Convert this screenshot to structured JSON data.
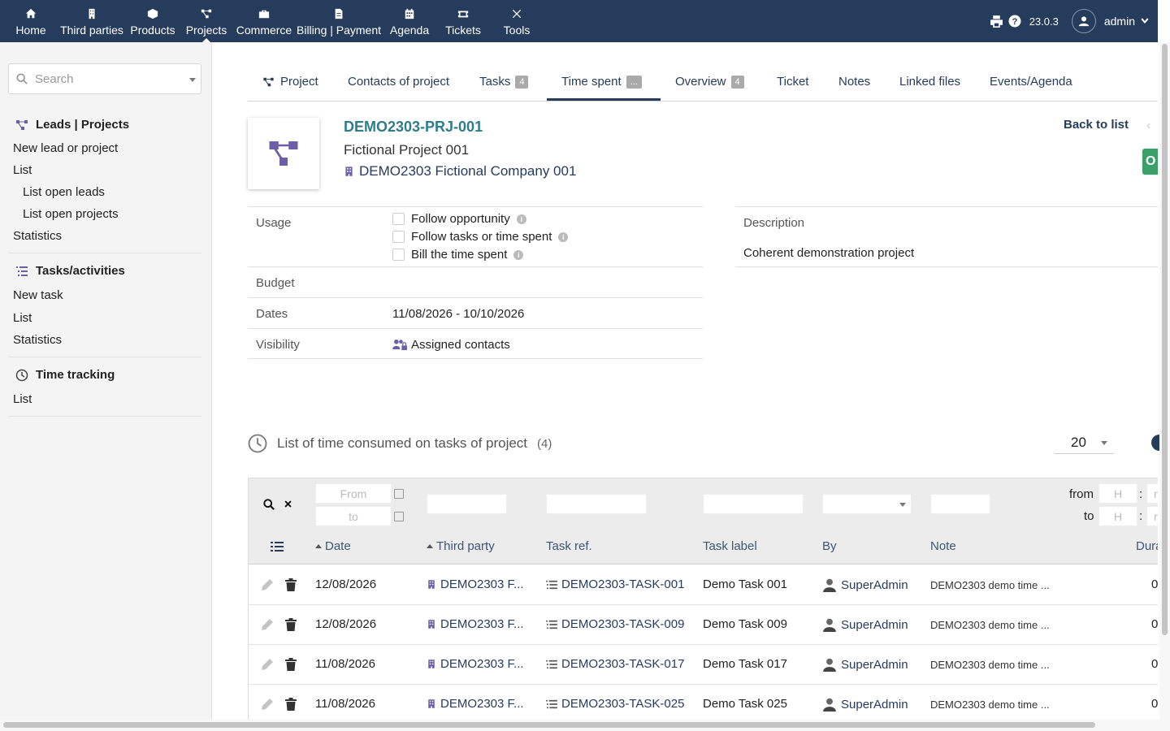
{
  "topnav": {
    "items": [
      {
        "label": "Home",
        "icon": "home-icon"
      },
      {
        "label": "Third parties",
        "icon": "building-icon"
      },
      {
        "label": "Products",
        "icon": "cube-icon"
      },
      {
        "label": "Projects",
        "icon": "project-tree-icon"
      },
      {
        "label": "Commerce",
        "icon": "suitcase-icon"
      },
      {
        "label": "Billing | Payment",
        "icon": "invoice-icon"
      },
      {
        "label": "Agenda",
        "icon": "calendar-icon"
      },
      {
        "label": "Tickets",
        "icon": "ticket-icon"
      },
      {
        "label": "Tools",
        "icon": "tools-icon"
      }
    ],
    "active": "Projects",
    "version": "23.0.3",
    "user": "admin"
  },
  "sidebar": {
    "search_placeholder": "Search",
    "leads_title": "Leads | Projects",
    "leads_links": [
      "New lead or project",
      "List",
      "List open leads",
      "List open projects",
      "Statistics"
    ],
    "tasks_title": "Tasks/activities",
    "tasks_links": [
      "New task",
      "List",
      "Statistics"
    ],
    "time_title": "Time tracking",
    "time_links": [
      "List"
    ]
  },
  "tabs": [
    {
      "label": "Project"
    },
    {
      "label": "Contacts of project"
    },
    {
      "label": "Tasks",
      "badge": "4"
    },
    {
      "label": "Time spent",
      "badge": "..."
    },
    {
      "label": "Overview",
      "badge": "4"
    },
    {
      "label": "Ticket"
    },
    {
      "label": "Notes"
    },
    {
      "label": "Linked files"
    },
    {
      "label": "Events/Agenda"
    }
  ],
  "active_tab": "Time spent",
  "project": {
    "ref": "DEMO2303-PRJ-001",
    "name": "Fictional Project 001",
    "company": "DEMO2303 Fictional Company 001",
    "back_to_list": "Back to list",
    "green_button_text": "O"
  },
  "fields": {
    "usage_label": "Usage",
    "usage_options": [
      "Follow opportunity",
      "Follow tasks or time spent",
      "Bill the time spent"
    ],
    "budget_label": "Budget",
    "budget_value": "",
    "dates_label": "Dates",
    "dates_value": "11/08/2026 - 10/10/2026",
    "visibility_label": "Visibility",
    "visibility_value": "Assigned contacts",
    "description_label": "Description",
    "description_value": "Coherent demonstration project"
  },
  "timelist": {
    "title": "List of time consumed on tasks of project",
    "count": "(4)",
    "per_page": "20",
    "filters": {
      "from_placeholder": "From",
      "to_placeholder": "to",
      "from_label": "from",
      "to_label": "to",
      "hour_placeholder": "H",
      "colon": ":",
      "minute_placeholder": "m"
    },
    "columns": [
      "Date",
      "Third party",
      "Task ref.",
      "Task label",
      "By",
      "Note",
      "Dura"
    ],
    "rows": [
      {
        "date": "12/08/2026",
        "thirdparty": "DEMO2303 F...",
        "taskref": "DEMO2303-TASK-001",
        "tasklabel": "Demo Task 001",
        "by": "SuperAdmin",
        "note": "DEMO2303 demo time ...",
        "duration": "0"
      },
      {
        "date": "12/08/2026",
        "thirdparty": "DEMO2303 F...",
        "taskref": "DEMO2303-TASK-009",
        "tasklabel": "Demo Task 009",
        "by": "SuperAdmin",
        "note": "DEMO2303 demo time ...",
        "duration": "0"
      },
      {
        "date": "11/08/2026",
        "thirdparty": "DEMO2303 F...",
        "taskref": "DEMO2303-TASK-017",
        "tasklabel": "Demo Task 017",
        "by": "SuperAdmin",
        "note": "DEMO2303 demo time ...",
        "duration": "0"
      },
      {
        "date": "11/08/2026",
        "thirdparty": "DEMO2303 F...",
        "taskref": "DEMO2303-TASK-025",
        "tasklabel": "Demo Task 025",
        "by": "SuperAdmin",
        "note": "DEMO2303 demo time ...",
        "duration": "0"
      }
    ]
  },
  "colors": {
    "topbar": "#263c5c",
    "link": "#263c5c",
    "ref": "#2e7d8a",
    "green": "#3aa067"
  }
}
